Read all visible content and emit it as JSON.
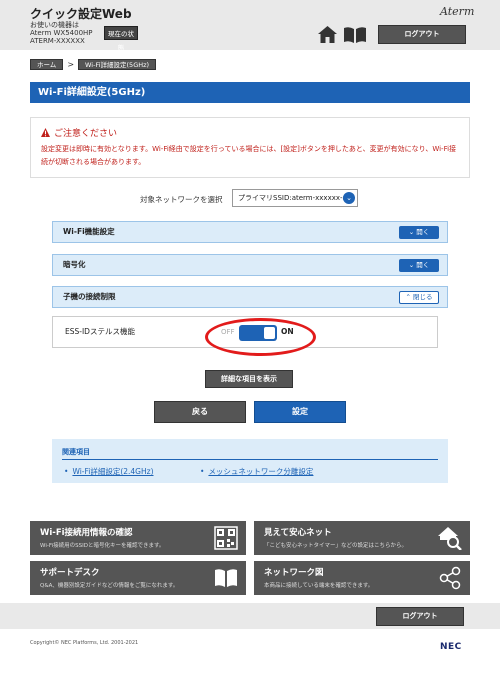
{
  "header": {
    "app_title": "クイック設定Web",
    "device_line1": "お使いの機器は",
    "device_line2": "Aterm WX5400HP",
    "device_line3": "ATERM-XXXXXX",
    "status_button": "現在の状態",
    "brand": "Aterm",
    "logout": "ログアウト"
  },
  "breadcrumb": {
    "home": "ホーム",
    "separator": ">",
    "current": "Wi-Fi詳細設定(5GHz)"
  },
  "page_title": "Wi-Fi詳細設定(5GHz)",
  "notice": {
    "icon": "warning-triangle-icon",
    "heading": "ご注意ください",
    "body": "設定変更は即時に有効となります。Wi-Fi経由で設定を行っている場合には、[設定]ボタンを押したあと、変更が有効になり、Wi-Fi接続が切断される場合があります。"
  },
  "network": {
    "label": "対象ネットワークを選択",
    "selected": "プライマリSSID:aterm-xxxxxx-a"
  },
  "sections": {
    "wifi": {
      "label": "Wi-Fi機能設定",
      "toggle": "開く"
    },
    "encryption": {
      "label": "暗号化",
      "toggle": "開く"
    },
    "client_limit": {
      "label": "子機の接続制限",
      "toggle": "閉じる"
    }
  },
  "stealth": {
    "label": "ESS-IDステルス機能",
    "off": "OFF",
    "on": "ON",
    "state": "on"
  },
  "buttons": {
    "details": "詳細な項目を表示",
    "back": "戻る",
    "apply": "設定"
  },
  "related": {
    "heading": "関連項目",
    "links": [
      "Wi-Fi詳細設定(2.4GHz)",
      "メッシュネットワーク分離設定"
    ]
  },
  "tiles": [
    {
      "title": "Wi-Fi接続用情報の確認",
      "desc": "Wi-Fi接続用のSSIDと暗号化キーを確認できます。",
      "icon": "qr-code-icon"
    },
    {
      "title": "見えて安心ネット",
      "desc": "「こども安心ネットタイマー」などの設定はこちらから。",
      "icon": "house-search-icon"
    },
    {
      "title": "サポートデスク",
      "desc": "Q&A、機器別設定ガイドなどの情報をご覧になれます。",
      "icon": "book-icon"
    },
    {
      "title": "ネットワーク図",
      "desc": "本商品に接続している端末を確認できます。",
      "icon": "network-share-icon"
    }
  ],
  "footer": {
    "logout": "ログアウト",
    "copyright": "Copyright© NEC Platforms, Ltd. 2001-2021",
    "logo": "NEC"
  },
  "colors": {
    "primary": "#1e63b5",
    "warning": "#c0201b",
    "highlight": "#e21b1b",
    "tile_bg": "#555555"
  }
}
